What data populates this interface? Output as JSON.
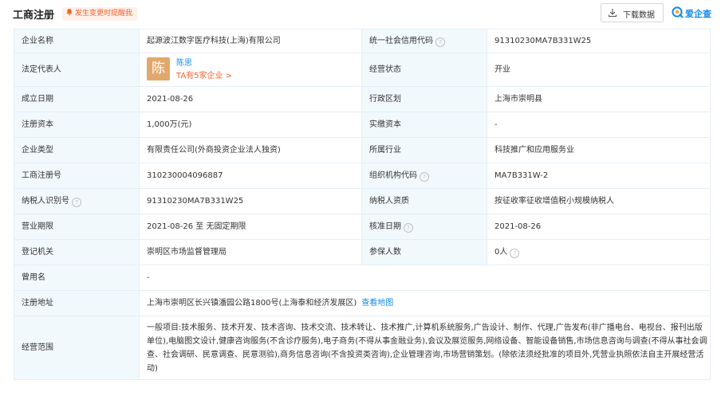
{
  "header": {
    "title": "工商注册",
    "remind_label": "发生变更时提醒我",
    "download_label": "下载数据",
    "brand_name": "爱企查",
    "brand_color": "#128bed",
    "accent_color": "#f2622e"
  },
  "fields": {
    "company_name_label": "企业名称",
    "company_name": "起源波江数字医疗科技(上海)有限公司",
    "credit_code_label": "统一社会信用代码",
    "credit_code": "91310230MA7B331W25",
    "legal_rep_label": "法定代表人",
    "legal_rep_avatar": "陈",
    "legal_rep_name": "陈思",
    "legal_rep_link": "TA有5家企业 >",
    "status_label": "经营状态",
    "status": "开业",
    "founded_label": "成立日期",
    "founded": "2021-08-26",
    "region_label": "行政区划",
    "region": "上海市崇明县",
    "reg_capital_label": "注册资本",
    "reg_capital": "1,000万(元)",
    "paid_capital_label": "实缴资本",
    "paid_capital": "-",
    "company_type_label": "企业类型",
    "company_type": "有限责任公司(外商投资企业法人独资)",
    "industry_label": "所属行业",
    "industry": "科技推广和应用服务业",
    "reg_no_label": "工商注册号",
    "reg_no": "310230004096887",
    "org_code_label": "组织机构代码",
    "org_code": "MA7B331W-2",
    "tax_id_label": "纳税人识别号",
    "tax_id": "91310230MA7B331W25",
    "tax_qual_label": "纳税人资质",
    "tax_qual": "按征收率征收增值税小规模纳税人",
    "term_label": "营业期限",
    "term": "2021-08-26 至 无固定期限",
    "approval_date_label": "核准日期",
    "approval_date": "2021-08-26",
    "authority_label": "登记机关",
    "authority": "崇明区市场监督管理局",
    "insured_label": "参保人数",
    "insured": "0人",
    "former_name_label": "曾用名",
    "former_name": "-",
    "address_label": "注册地址",
    "address": "上海市崇明区长兴镇潘园公路1800号(上海泰和经济发展区)",
    "map_link": "查看地图",
    "scope_label": "经营范围",
    "scope": "一般项目:技术服务、技术开发、技术咨询、技术交流、技术转让、技术推广,计算机系统服务,广告设计、制作、代理,广告发布(非广播电台、电视台、报刊出版单位),电脑图文设计,健康咨询服务(不含诊疗服务),电子商务(不得从事金融业务),会议及展览服务,网络设备、智能设备销售,市场信息咨询与调查(不得从事社会调查、社会调研、民意调查、民意测验),商务信息咨询(不含投资类咨询),企业管理咨询,市场营销策划。(除依法须经批准的项目外,凭营业执照依法自主开展经营活动)"
  }
}
